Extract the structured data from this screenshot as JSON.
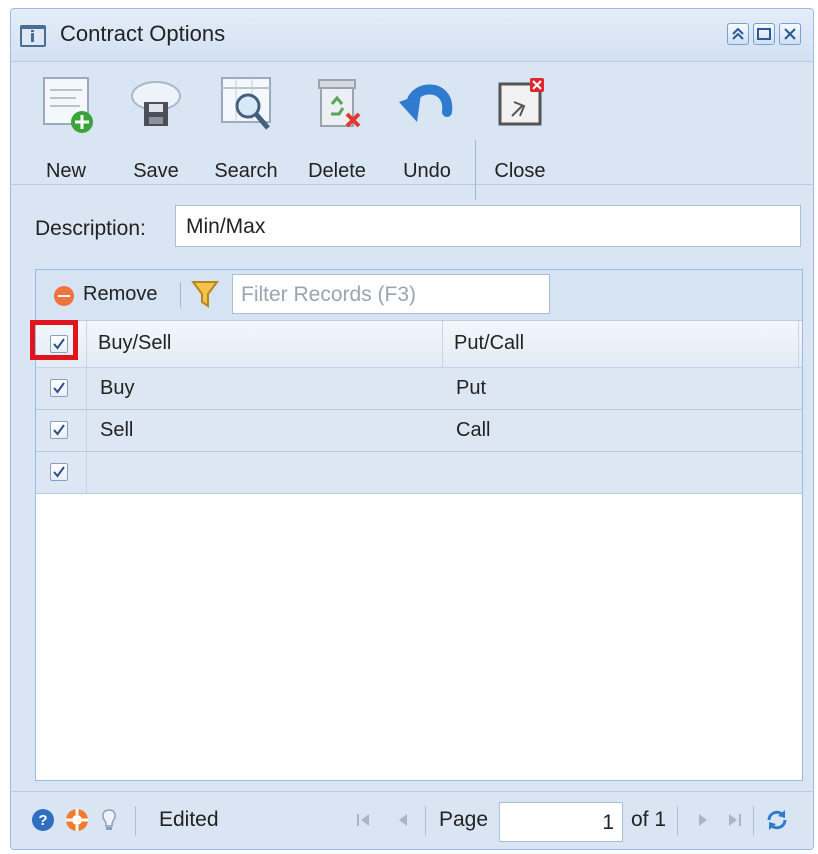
{
  "window": {
    "title": "Contract Options"
  },
  "toolbar": {
    "buttons": [
      {
        "label": "New",
        "icon": "new-icon"
      },
      {
        "label": "Save",
        "icon": "save-icon"
      },
      {
        "label": "Search",
        "icon": "search-icon"
      },
      {
        "label": "Delete",
        "icon": "delete-icon"
      },
      {
        "label": "Undo",
        "icon": "undo-icon"
      },
      {
        "label": "Close",
        "icon": "close-window-icon"
      }
    ]
  },
  "form": {
    "description_label": "Description:",
    "description_value": "Min/Max"
  },
  "grid": {
    "toolbar": {
      "remove_label": "Remove",
      "filter_placeholder": "Filter Records (F3)"
    },
    "columns": [
      "Buy/Sell",
      "Put/Call"
    ],
    "header_checked": true,
    "rows": [
      {
        "checked": true,
        "buy_sell": "Buy",
        "put_call": "Put"
      },
      {
        "checked": true,
        "buy_sell": "Sell",
        "put_call": "Call"
      },
      {
        "checked": true,
        "buy_sell": "",
        "put_call": ""
      }
    ]
  },
  "statusbar": {
    "status": "Edited",
    "page_label": "Page",
    "page_value": "1",
    "of_label": "of 1"
  },
  "colors": {
    "accent": "#99bbe8",
    "highlight": "#e0151b",
    "row_background": "#dde7f3"
  }
}
